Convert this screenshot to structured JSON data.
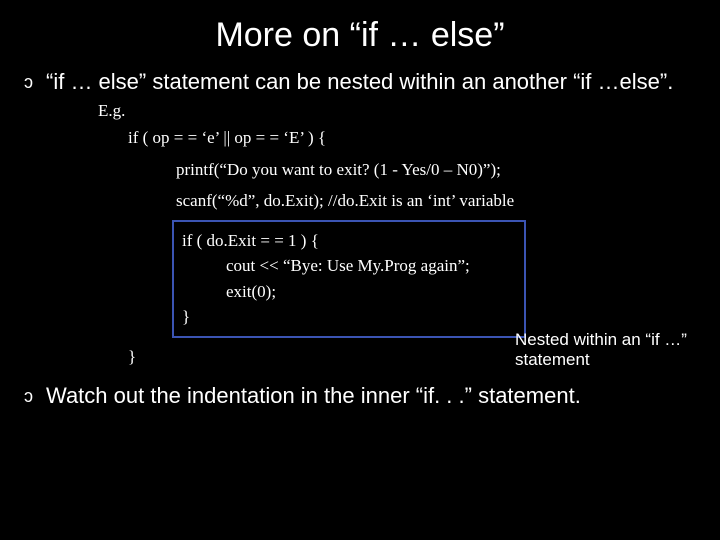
{
  "title": "More on “if … else”",
  "bullets": [
    "“if … else” statement can be nested within an another “if …else”.",
    "Watch out the indentation in the inner “if. . .” statement."
  ],
  "eg": "E.g.",
  "code": {
    "l0": "if ( op = =  ‘e’ || op = = ‘E’ ) {",
    "l1": "printf(“Do you want to exit? (1 - Yes/0 – N0)”);",
    "l2": "scanf(“%d”, do.Exit); //do.Exit is an ‘int’ variable",
    "l3": "if ( do.Exit = = 1 ) {",
    "l4": "cout << “Bye: Use My.Prog again”;",
    "l5": "exit(0);",
    "l6": "}",
    "l7": "}"
  },
  "callout": "Nested within an “if …” statement",
  "icons": {
    "bullet": "ͻ"
  }
}
